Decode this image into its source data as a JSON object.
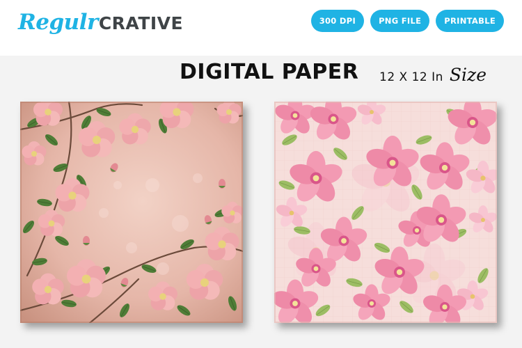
{
  "brand": {
    "script_part": "Regulr",
    "block_part": "CRATIVE",
    "color": "#1fb3e4"
  },
  "badges": [
    "300 DPI",
    "PNG FILE",
    "PRINTABLE"
  ],
  "title": "DIGITAL PAPER",
  "size": {
    "dims": "12 X 12 In",
    "word": "Size"
  },
  "papers": [
    {
      "name": "vintage-pink-blossom-paper",
      "base": "#e8bcb2",
      "flower": "#eaa6ad",
      "leaf": "#4c7a3a"
    },
    {
      "name": "pink-dogwood-floral-paper",
      "base": "#f5dcd8",
      "flower": "#f08aa6",
      "leaf": "#8fb25a"
    }
  ]
}
